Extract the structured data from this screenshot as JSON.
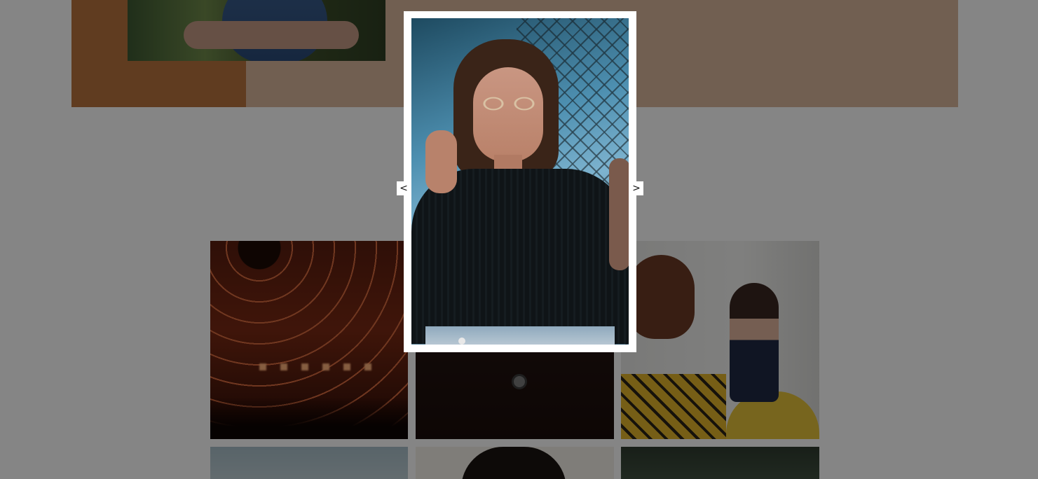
{
  "lightbox": {
    "prev_label": "<",
    "next_label": ">"
  },
  "colors": {
    "overlay": "rgba(0,0,0,0.48)",
    "hero_band": "#d9b79c",
    "hero_accent": "#b8733f",
    "lightbox_frame": "#ffffff"
  }
}
